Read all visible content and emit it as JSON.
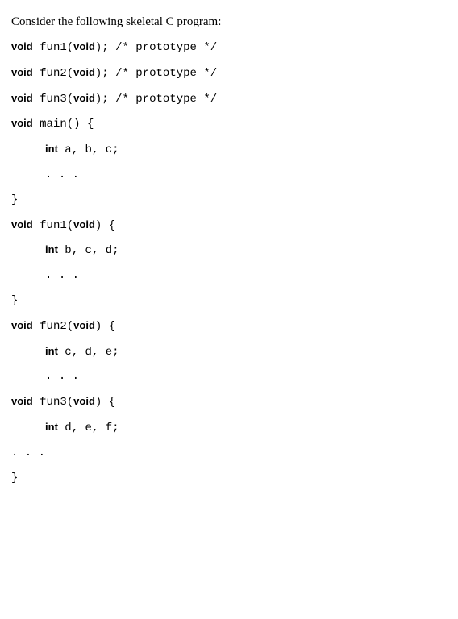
{
  "intro": "Consider the following skeletal C program:",
  "lines": [
    {
      "kw": "void",
      "code": " fun1(",
      "kw2": "void",
      "code2": "); /* prototype */",
      "indent": 0
    },
    {
      "kw": "void",
      "code": " fun2(",
      "kw2": "void",
      "code2": "); /* prototype */",
      "indent": 0
    },
    {
      "kw": "void",
      "code": " fun3(",
      "kw2": "void",
      "code2": "); /* prototype */",
      "indent": 0
    },
    {
      "kw": "void",
      "code": " main() {",
      "indent": 0
    },
    {
      "kw": "int",
      "code": " a, b, c;",
      "indent": 1
    },
    {
      "code": ". . .",
      "indent": 1
    },
    {
      "code": "}",
      "indent": 0
    },
    {
      "kw": "void",
      "code": " fun1(",
      "kw2": "void",
      "code2": ") {",
      "indent": 0
    },
    {
      "kw": "int",
      "code": " b, c, d;",
      "indent": 1
    },
    {
      "code": ". . .",
      "indent": 1
    },
    {
      "code": "}",
      "indent": 0
    },
    {
      "kw": "void",
      "code": " fun2(",
      "kw2": "void",
      "code2": ") {",
      "indent": 0
    },
    {
      "kw": "int",
      "code": " c, d, e;",
      "indent": 1
    },
    {
      "code": ". . .",
      "indent": 1
    },
    {
      "kw": "void",
      "code": " fun3(",
      "kw2": "void",
      "code2": ") {",
      "indent": 0
    },
    {
      "kw": "int",
      "code": " d, e, f;",
      "indent": 1
    },
    {
      "code": ". . .",
      "indent": 0
    },
    {
      "code": "}",
      "indent": 0
    }
  ]
}
